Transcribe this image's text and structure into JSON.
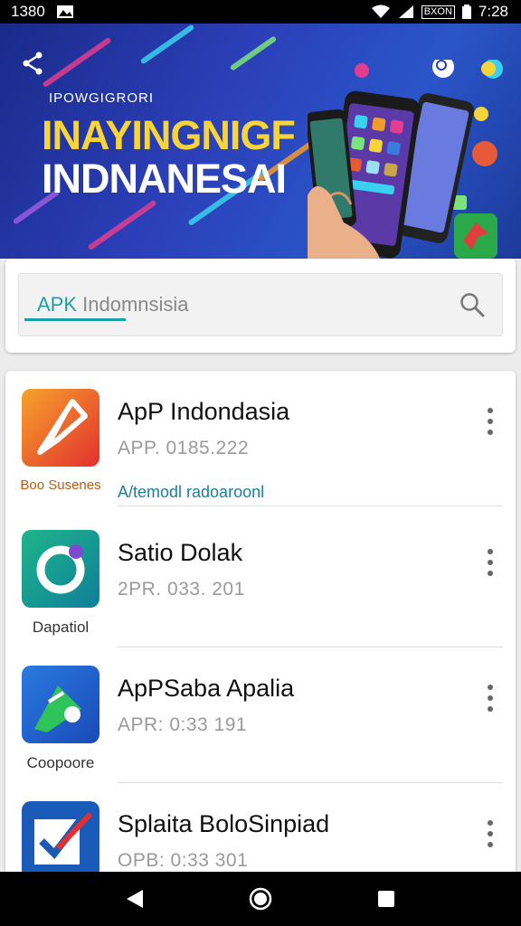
{
  "status_bar": {
    "time_left": "1380",
    "time_right": "7:28",
    "battery_label": "BXON"
  },
  "banner": {
    "kicker": "IPOWGIGRORI",
    "title_line1": "INAYINGNIGF",
    "title_line2": "INDNANESAI"
  },
  "search": {
    "accent_text": "APK",
    "query_text": "Indomnsisia"
  },
  "apps": [
    {
      "title": "ApP Indondasia",
      "subtitle": "APP. 0185.222",
      "caption": "Boo Susenes",
      "extra": "A/temodl radoaroonl"
    },
    {
      "title": "Satio Dolak",
      "subtitle": "2PR. 033. 201",
      "caption": "Dapatiol",
      "extra": ""
    },
    {
      "title": "ApPSaba Apalia",
      "subtitle": "APR: 0:33 191",
      "caption": "Coopoore",
      "extra": ""
    },
    {
      "title": "Splaita BoloSinpiad",
      "subtitle": "OPB: 0:33 301",
      "caption": "",
      "extra": ""
    }
  ],
  "colors": {
    "accent": "#1aa0a8",
    "banner_bg": "#2b3fb8",
    "title_yellow": "#f7d43a"
  },
  "icons": [
    "share-icon",
    "search-icon",
    "more-vert-icon",
    "back-icon",
    "home-icon",
    "recents-icon"
  ]
}
